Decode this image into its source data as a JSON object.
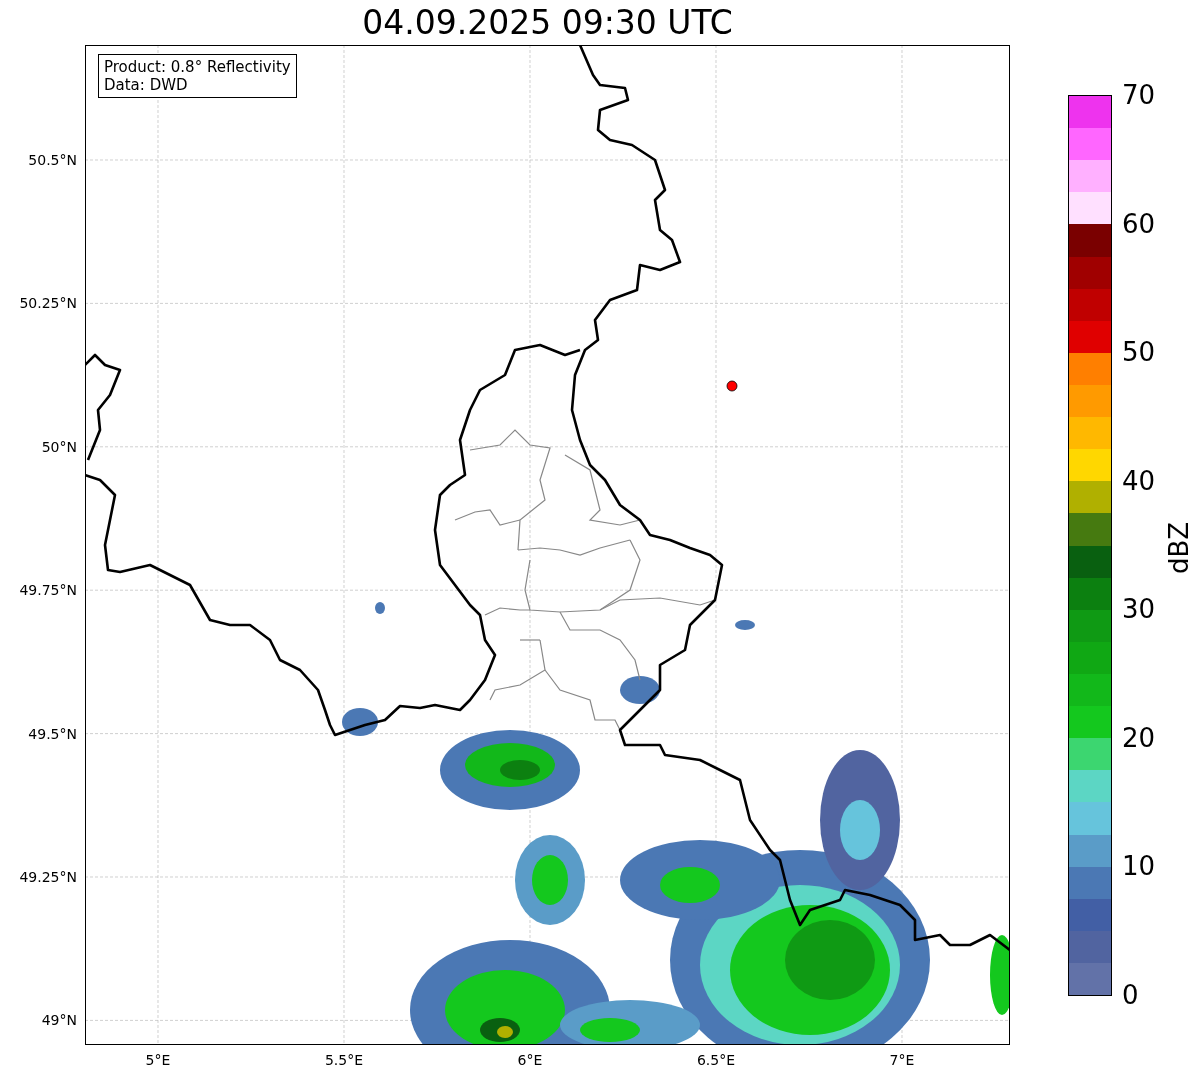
{
  "title": "04.09.2025 09:30 UTC",
  "legend": [
    "Product: 0.8° Reflectivity",
    "Data: DWD"
  ],
  "y_ticks": [
    "50.5°N",
    "50.25°N",
    "50°N",
    "49.75°N",
    "49.5°N",
    "49.25°N",
    "49°N"
  ],
  "x_ticks": [
    "5°E",
    "5.5°E",
    "6°E",
    "6.5°E",
    "7°E"
  ],
  "colorbar": {
    "label": "dBZ",
    "ticks": [
      "70",
      "60",
      "50",
      "40",
      "30",
      "20",
      "10",
      "0"
    ],
    "bands": [
      {
        "color": "#ee33ee"
      },
      {
        "color": "#ff66ff"
      },
      {
        "color": "#ffb0ff"
      },
      {
        "color": "#ffe0ff"
      },
      {
        "color": "#7a0000"
      },
      {
        "color": "#a00000"
      },
      {
        "color": "#c00000"
      },
      {
        "color": "#e00000"
      },
      {
        "color": "#ff7f00"
      },
      {
        "color": "#ff9a00"
      },
      {
        "color": "#ffb800"
      },
      {
        "color": "#ffd700"
      },
      {
        "color": "#b0b000"
      },
      {
        "color": "#467a10"
      },
      {
        "color": "#096010"
      },
      {
        "color": "#0c8010"
      },
      {
        "color": "#0f9a14"
      },
      {
        "color": "#10a814"
      },
      {
        "color": "#12b81a"
      },
      {
        "color": "#14c81e"
      },
      {
        "color": "#3cd670"
      },
      {
        "color": "#5cd6c4"
      },
      {
        "color": "#66c4dc"
      },
      {
        "color": "#5a9cc8"
      },
      {
        "color": "#4b78b4"
      },
      {
        "color": "#425fa5"
      },
      {
        "color": "#5164a0"
      },
      {
        "color": "#6272a8"
      }
    ]
  }
}
